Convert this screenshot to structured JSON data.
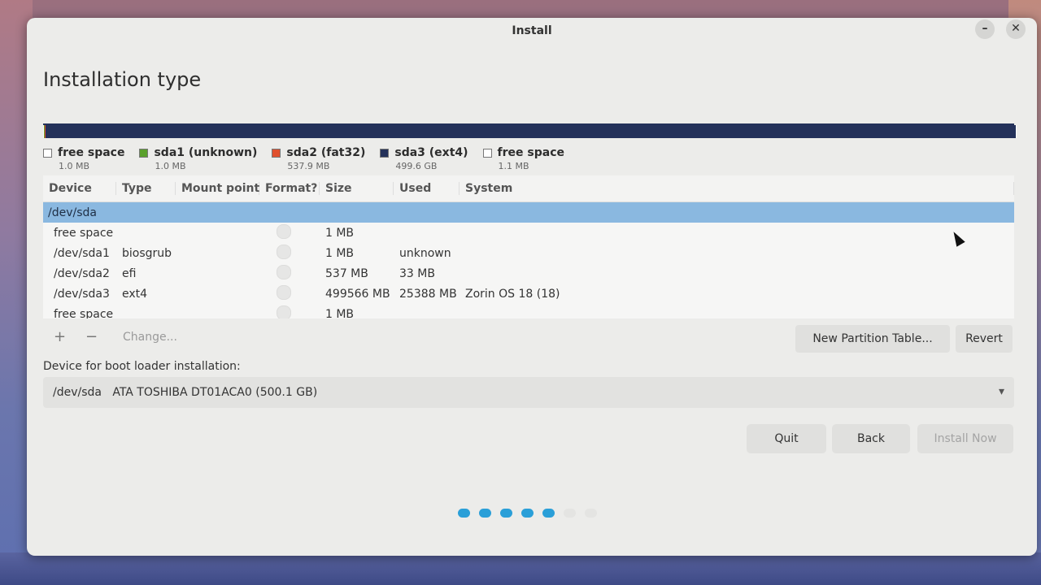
{
  "window": {
    "title": "Install",
    "minimize_glyph": "–",
    "close_glyph": "✕"
  },
  "page_title": "Installation type",
  "colors": {
    "free_space": "#ffffff",
    "sda1": "#5aa02c",
    "sda2": "#e0502e",
    "sda3": "#24315a",
    "selected_row": "#8ab8e0",
    "progress_active": "#2a9fd8",
    "progress_inactive": "#e4e4e2"
  },
  "disk_bar": [
    {
      "name": "free space",
      "fraction": 2e-06
    },
    {
      "name": "sda1",
      "fraction": 2e-06
    },
    {
      "name": "sda2",
      "fraction": 0.001074
    },
    {
      "name": "sda3",
      "fraction": 0.998922
    },
    {
      "name": "free space",
      "fraction": 2e-06
    }
  ],
  "legend": [
    {
      "label": "free space",
      "size": "1.0 MB",
      "color_key": "free_space"
    },
    {
      "label": "sda1 (unknown)",
      "size": "1.0 MB",
      "color_key": "sda1"
    },
    {
      "label": "sda2 (fat32)",
      "size": "537.9 MB",
      "color_key": "sda2"
    },
    {
      "label": "sda3 (ext4)",
      "size": "499.6 GB",
      "color_key": "sda3"
    },
    {
      "label": "free space",
      "size": "1.1 MB",
      "color_key": "free_space"
    }
  ],
  "table": {
    "columns": {
      "device": "Device",
      "type": "Type",
      "mount": "Mount point",
      "format": "Format?",
      "size": "Size",
      "used": "Used",
      "system": "System"
    },
    "rows": [
      {
        "device": "/dev/sda",
        "type": "",
        "mount": "",
        "size": "",
        "used": "",
        "system": "",
        "selected": true
      },
      {
        "device": "free space",
        "type": "",
        "mount": "",
        "size": "1 MB",
        "used": "",
        "system": ""
      },
      {
        "device": "/dev/sda1",
        "type": "biosgrub",
        "mount": "",
        "size": "1 MB",
        "used": "unknown",
        "system": ""
      },
      {
        "device": "/dev/sda2",
        "type": "efi",
        "mount": "",
        "size": "537 MB",
        "used": "33 MB",
        "system": ""
      },
      {
        "device": "/dev/sda3",
        "type": "ext4",
        "mount": "",
        "size": "499566 MB",
        "used": "25388 MB",
        "system": "Zorin OS 18 (18)"
      },
      {
        "device": "free space",
        "type": "",
        "mount": "",
        "size": "1 MB",
        "used": "",
        "system": ""
      }
    ]
  },
  "toolbar": {
    "add_label": "+",
    "remove_label": "−",
    "change_label": "Change...",
    "new_partition_table_label": "New Partition Table...",
    "revert_label": "Revert"
  },
  "bootloader": {
    "label": "Device for boot loader installation:",
    "selected_value": "/dev/sda   ATA TOSHIBA DT01ACA0 (500.1 GB)",
    "arrow_icon": "▾"
  },
  "buttons": {
    "quit": "Quit",
    "back": "Back",
    "install_now": "Install Now"
  },
  "progress": {
    "total_steps": 7,
    "completed_steps": 5
  }
}
